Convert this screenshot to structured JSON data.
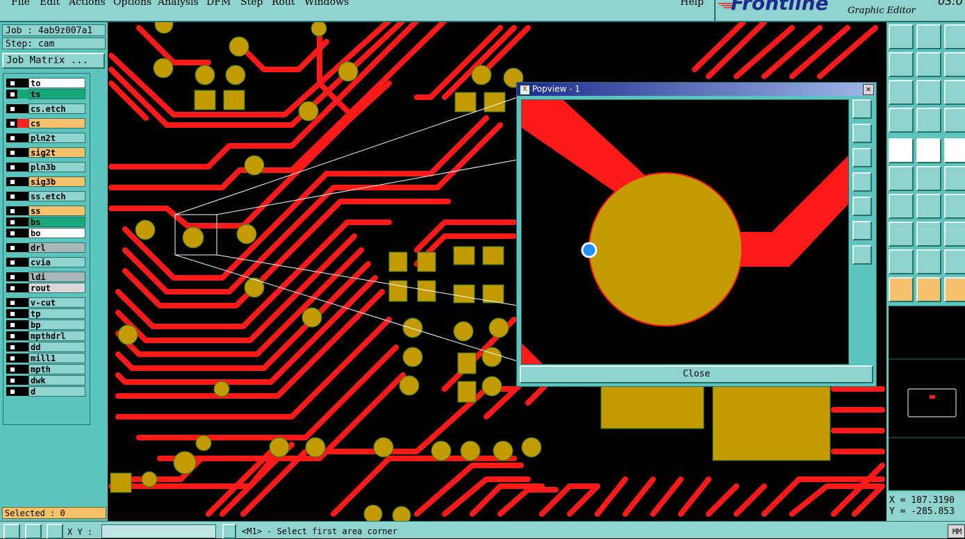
{
  "menubar": {
    "items": [
      {
        "label": "File"
      },
      {
        "label": "Edit"
      },
      {
        "label": "Actions"
      },
      {
        "label": "Options"
      },
      {
        "label": "Analysis"
      },
      {
        "label": "DFM"
      },
      {
        "label": "Step"
      },
      {
        "label": "Rout"
      },
      {
        "label": "Windows"
      },
      {
        "label": "Help"
      }
    ]
  },
  "brand": {
    "logo": "Frontline",
    "subtitle": "Graphic Editor",
    "clock": "03:0"
  },
  "job": {
    "job_label": "Job : 4ab9z007a1",
    "step_label": "Step: cam",
    "matrix_button": "Job Matrix ..."
  },
  "layers": [
    {
      "name": "to",
      "bg": "#ffffff",
      "color": "#000000"
    },
    {
      "name": "ts",
      "bg": "#17a879",
      "color": "#17a879"
    },
    {
      "name": "cs.etch",
      "bg": "#8fd3cf",
      "color": "#000000"
    },
    {
      "name": "cs",
      "bg": "#f5c26b",
      "color": "#ff2020",
      "active": true
    },
    {
      "name": "pln2t",
      "bg": "#8fd3cf",
      "color": "#000000"
    },
    {
      "name": "sig2t",
      "bg": "#f5c26b",
      "color": "#000000"
    },
    {
      "name": "pln3b",
      "bg": "#8fd3cf",
      "color": "#000000"
    },
    {
      "name": "sig3b",
      "bg": "#f5c26b",
      "color": "#000000"
    },
    {
      "name": "ss.etch",
      "bg": "#8fd3cf",
      "color": "#000000"
    },
    {
      "name": "ss",
      "bg": "#f5c26b",
      "color": "#000000"
    },
    {
      "name": "bs",
      "bg": "#17a879",
      "color": "#000000"
    },
    {
      "name": "bo",
      "bg": "#ffffff",
      "color": "#000000"
    },
    {
      "name": "drl",
      "bg": "#a8b8b8",
      "color": "#000000"
    },
    {
      "name": "cvia",
      "bg": "#8fd3cf",
      "color": "#000000"
    },
    {
      "name": "ldi",
      "bg": "#a8b8b8",
      "color": "#000000"
    },
    {
      "name": "rout",
      "bg": "#d8d8d8",
      "color": "#000000"
    },
    {
      "name": "v-cut",
      "bg": "#8fd3cf",
      "color": "#000000"
    },
    {
      "name": "tp",
      "bg": "#8fd3cf",
      "color": "#000000"
    },
    {
      "name": "bp",
      "bg": "#8fd3cf",
      "color": "#000000"
    },
    {
      "name": "mpthdrl",
      "bg": "#8fd3cf",
      "color": "#000000"
    },
    {
      "name": "dd",
      "bg": "#8fd3cf",
      "color": "#000000"
    },
    {
      "name": "mill1",
      "bg": "#8fd3cf",
      "color": "#000000"
    },
    {
      "name": "mpth",
      "bg": "#8fd3cf",
      "color": "#000000"
    },
    {
      "name": "dwk",
      "bg": "#8fd3cf",
      "color": "#000000"
    },
    {
      "name": "d",
      "bg": "#8fd3cf",
      "color": "#000000"
    }
  ],
  "selected": "Selected : 0",
  "popview": {
    "title": "Popview - 1",
    "close_button": "Close"
  },
  "coords": {
    "x": "X = 107.3190",
    "y": "Y = -285.853"
  },
  "status": {
    "xy_label": "X Y :",
    "xy_value": "",
    "message": "<M1> - Select first area corner",
    "units": "MM"
  },
  "colors": {
    "copper": "#ff1a1a",
    "pad": "#c39a00",
    "panel": "#5bc5bd",
    "button": "#8fd3cf"
  }
}
